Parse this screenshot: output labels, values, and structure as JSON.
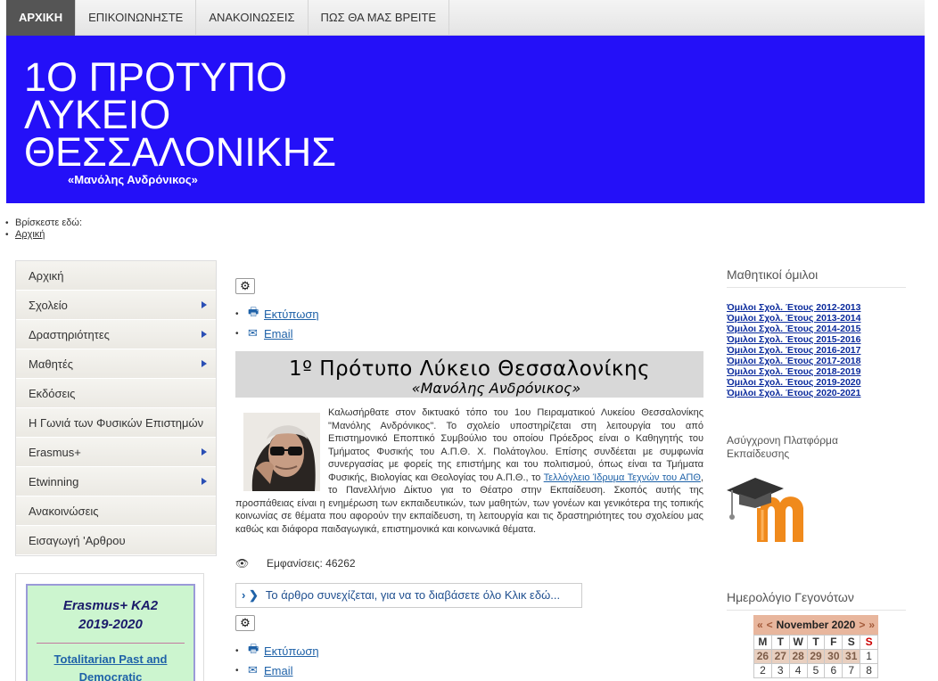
{
  "nav": {
    "items": [
      "ΑΡΧΙΚΗ",
      "ΕΠΙΚΟΙΝΩΝΗΣΤΕ",
      "ΑΝΑΚΟΙΝΩΣΕΙΣ",
      "ΠΩΣ ΘΑ ΜΑΣ ΒΡΕΙΤΕ"
    ]
  },
  "banner": {
    "title_line1": "1Ο ΠΡΟΤΥΠΟ",
    "title_line2": "ΛΥΚΕΙΟ",
    "title_line3": "ΘΕΣΣΑΛΟΝΙΚΗΣ",
    "subtitle": "«Μανόλης Ανδρόνικος»",
    "bg_color": "#2410f8"
  },
  "breadcrumb": {
    "label": "Βρίσκεστε εδώ:",
    "home": "Αρχική"
  },
  "left_menu": {
    "items": [
      {
        "label": "Αρχική"
      },
      {
        "label": "Σχολείο"
      },
      {
        "label": "Δραστηριότητες"
      },
      {
        "label": "Μαθητές"
      },
      {
        "label": "Εκδόσεις"
      },
      {
        "label": "Η Γωνιά των Φυσικών Επιστημών"
      },
      {
        "label": "Erasmus+"
      },
      {
        "label": "Etwinning"
      },
      {
        "label": "Ανακοινώσεις"
      },
      {
        "label": "Εισαγωγή 'Αρθρου"
      }
    ]
  },
  "erasmus": {
    "title_line1": "Erasmus+ KA2",
    "title_line2": "2019-2020",
    "link_line1": "Totalitarian Past and",
    "link_line2": "Democratic"
  },
  "article": {
    "print_label": "Εκτύπωση",
    "email_label": "Email",
    "heading": "1º Πρότυπο Λύκειο Θεσσαλονίκης",
    "subheading": "«Μανόλης Ανδρόνικος»",
    "body_before_link": "Καλωσήρθατε στον δικτυακό τόπο του 1ου Πειραματικού Λυκείου Θεσσαλονίκης \"Μανόλης Ανδρόνικος\". Το σχολείο υποστηρίζεται στη λειτουργία του από Επιστημονικό Εποπτικό Συμβούλιο του οποίου Πρόεδρος είναι ο Καθηγητής του Τμήματος Φυσικής του Α.Π.Θ. Χ. Πολάτογλου. Επίσης συνδέεται με συμφωνία συνεργασίας με φορείς της επιστήμης και του πολιτισμού, όπως είναι τα Τμήματα Φυσικής, Βιολογίας και Θεολογίας του Α.Π.Θ., το ",
    "body_link": "Τελλόγλειο Ίδρυμα Τεχνών του ΑΠΘ",
    "body_after_link": ", το Πανελλήνιο Δίκτυο για το Θέατρο στην Εκπαίδευση. Σκοπός αυτής της προσπάθειας είναι η ενημέρωση των εκπαιδευτικών, των μαθητών, των γονέων και γενικότερα της τοπικής κοινωνίας σε θέματα που αφορούν την εκπαίδευση, τη λειτουργία και τις δραστηριότητες του σχολείου μας καθώς και διάφορα παιδαγωγικά, επιστημονικά και κοινωνικά θέματα.",
    "views": "Εμφανίσεις: 46262",
    "read_more": "Το άρθρο συνεχίζεται, για να το διαβάσετε όλο Κλικ εδώ..."
  },
  "right": {
    "clubs_title": "Μαθητικοί όμιλοι",
    "clubs": [
      "Όμιλοι Σχολ. Έτους 2012-2013",
      "Όμιλοι Σχολ. Έτους 2013-2014",
      "Όμιλοι Σχολ. Έτους 2014-2015",
      "Όμιλοι Σχολ. Έτους 2015-2016",
      "Όμιλοι Σχολ. Έτους 2016-2017",
      "Όμιλοι Σχολ. Έτους 2017-2018",
      "Όμιλοι Σχολ. Έτους 2018-2019",
      "Όμιλοι Σχολ. Έτους 2019-2020",
      "Όμιλοι Σχολ. Έτους 2020-2021"
    ],
    "platform_title": "Ασύγχρονη Πλατφόρμα Εκπαίδευσης",
    "calendar_title": "Ημερολόγιο Γεγονότων",
    "calendar": {
      "prev_year": "«",
      "prev_month": "<",
      "month": "November 2020",
      "next_month": ">",
      "next_year": "»",
      "weekdays": [
        "M",
        "T",
        "W",
        "T",
        "F",
        "S",
        "S"
      ],
      "row1": [
        "26",
        "27",
        "28",
        "29",
        "30",
        "31",
        "1"
      ],
      "row2": [
        "2",
        "3",
        "4",
        "5",
        "6",
        "7",
        "8"
      ]
    }
  }
}
